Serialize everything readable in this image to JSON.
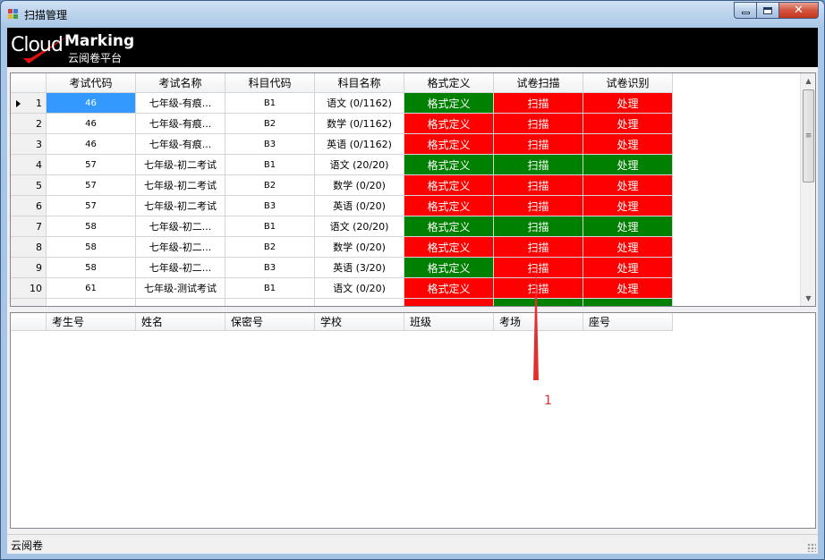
{
  "window": {
    "title": "扫描管理"
  },
  "banner": {
    "brand_cloud": "Cloud",
    "brand_marking": "Marking",
    "subtitle": "云阅卷平台"
  },
  "exam_grid": {
    "columns": [
      "考试代码",
      "考试名称",
      "科目代码",
      "科目名称",
      "格式定义",
      "试卷扫描",
      "试卷识别"
    ],
    "rows": [
      {
        "num": "1",
        "code": "46",
        "name": "七年级-有痕...",
        "subj": "B1",
        "subj_name": "语文 (0/1162)",
        "fmt": "格式定义",
        "fmt_c": "green",
        "scan": "扫描",
        "scan_c": "red",
        "proc": "处理",
        "proc_c": "red"
      },
      {
        "num": "2",
        "code": "46",
        "name": "七年级-有痕...",
        "subj": "B2",
        "subj_name": "数学 (0/1162)",
        "fmt": "格式定义",
        "fmt_c": "red",
        "scan": "扫描",
        "scan_c": "red",
        "proc": "处理",
        "proc_c": "red"
      },
      {
        "num": "3",
        "code": "46",
        "name": "七年级-有痕...",
        "subj": "B3",
        "subj_name": "英语 (0/1162)",
        "fmt": "格式定义",
        "fmt_c": "red",
        "scan": "扫描",
        "scan_c": "red",
        "proc": "处理",
        "proc_c": "red"
      },
      {
        "num": "4",
        "code": "57",
        "name": "七年级-初二考试",
        "subj": "B1",
        "subj_name": "语文 (20/20)",
        "fmt": "格式定义",
        "fmt_c": "green",
        "scan": "扫描",
        "scan_c": "green",
        "proc": "处理",
        "proc_c": "green"
      },
      {
        "num": "5",
        "code": "57",
        "name": "七年级-初二考试",
        "subj": "B2",
        "subj_name": "数学 (0/20)",
        "fmt": "格式定义",
        "fmt_c": "red",
        "scan": "扫描",
        "scan_c": "red",
        "proc": "处理",
        "proc_c": "red"
      },
      {
        "num": "6",
        "code": "57",
        "name": "七年级-初二考试",
        "subj": "B3",
        "subj_name": "英语 (0/20)",
        "fmt": "格式定义",
        "fmt_c": "red",
        "scan": "扫描",
        "scan_c": "red",
        "proc": "处理",
        "proc_c": "red"
      },
      {
        "num": "7",
        "code": "58",
        "name": "七年级-初二...",
        "subj": "B1",
        "subj_name": "语文 (20/20)",
        "fmt": "格式定义",
        "fmt_c": "green",
        "scan": "扫描",
        "scan_c": "green",
        "proc": "处理",
        "proc_c": "green"
      },
      {
        "num": "8",
        "code": "58",
        "name": "七年级-初二...",
        "subj": "B2",
        "subj_name": "数学 (0/20)",
        "fmt": "格式定义",
        "fmt_c": "red",
        "scan": "扫描",
        "scan_c": "red",
        "proc": "处理",
        "proc_c": "red"
      },
      {
        "num": "9",
        "code": "58",
        "name": "七年级-初二...",
        "subj": "B3",
        "subj_name": "英语 (3/20)",
        "fmt": "格式定义",
        "fmt_c": "green",
        "scan": "扫描",
        "scan_c": "red",
        "proc": "处理",
        "proc_c": "red"
      },
      {
        "num": "10",
        "code": "61",
        "name": "七年级-测试考试",
        "subj": "B1",
        "subj_name": "语文 (0/20)",
        "fmt": "格式定义",
        "fmt_c": "red",
        "scan": "扫描",
        "scan_c": "red",
        "proc": "处理",
        "proc_c": "red"
      }
    ]
  },
  "student_grid": {
    "columns": [
      "考生号",
      "姓名",
      "保密号",
      "学校",
      "班级",
      "考场",
      "座号"
    ]
  },
  "status_bar": {
    "text": "云阅卷"
  },
  "annotation": {
    "label": "1",
    "color": "#e03030"
  },
  "colors": {
    "red": "#ff0000",
    "green": "#008000",
    "selection": "#3399ff"
  }
}
